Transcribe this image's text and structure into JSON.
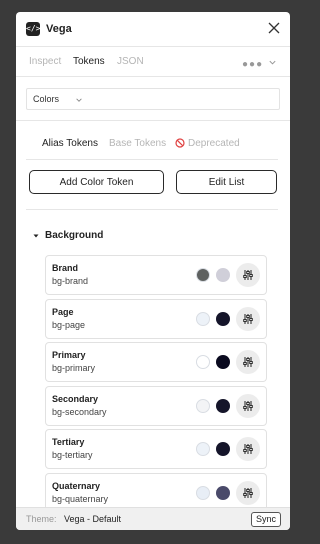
{
  "app": {
    "title": "Vega",
    "logo_glyph": "</>"
  },
  "tabs": [
    {
      "label": "Inspect",
      "active": false
    },
    {
      "label": "Tokens",
      "active": true
    },
    {
      "label": "JSON",
      "active": false
    }
  ],
  "category_select": {
    "value": "Colors"
  },
  "sub_tabs": {
    "alias": "Alias Tokens",
    "base": "Base Tokens",
    "deprecated": "Deprecated"
  },
  "actions": {
    "add_label": "Add Color Token",
    "edit_label": "Edit List"
  },
  "group": {
    "title": "Background"
  },
  "tokens": [
    {
      "name": "Brand",
      "variable": "bg-brand",
      "light": "#5e6160",
      "dark": "#d0cfd9"
    },
    {
      "name": "Page",
      "variable": "bg-page",
      "light": "#edf2f8",
      "dark": "#15152a"
    },
    {
      "name": "Primary",
      "variable": "bg-primary",
      "light": "#ffffff",
      "dark": "#0a0a1f"
    },
    {
      "name": "Secondary",
      "variable": "bg-secondary",
      "light": "#f3f4f6",
      "dark": "#15152a"
    },
    {
      "name": "Tertiary",
      "variable": "bg-tertiary",
      "light": "#edf2f8",
      "dark": "#15152a"
    },
    {
      "name": "Quaternary",
      "variable": "bg-quaternary",
      "light": "#e8eef6",
      "dark": "#4a4a6a"
    }
  ],
  "footer": {
    "theme_label": "Theme:",
    "theme_value": "Vega - Default",
    "sync_label": "Sync"
  },
  "icons": {
    "logo": "code-icon",
    "close": "close-icon",
    "more": "more-dots-icon",
    "deprecated": "ban-icon",
    "caret": "caret-down-icon",
    "adjust": "sliders-icon"
  }
}
